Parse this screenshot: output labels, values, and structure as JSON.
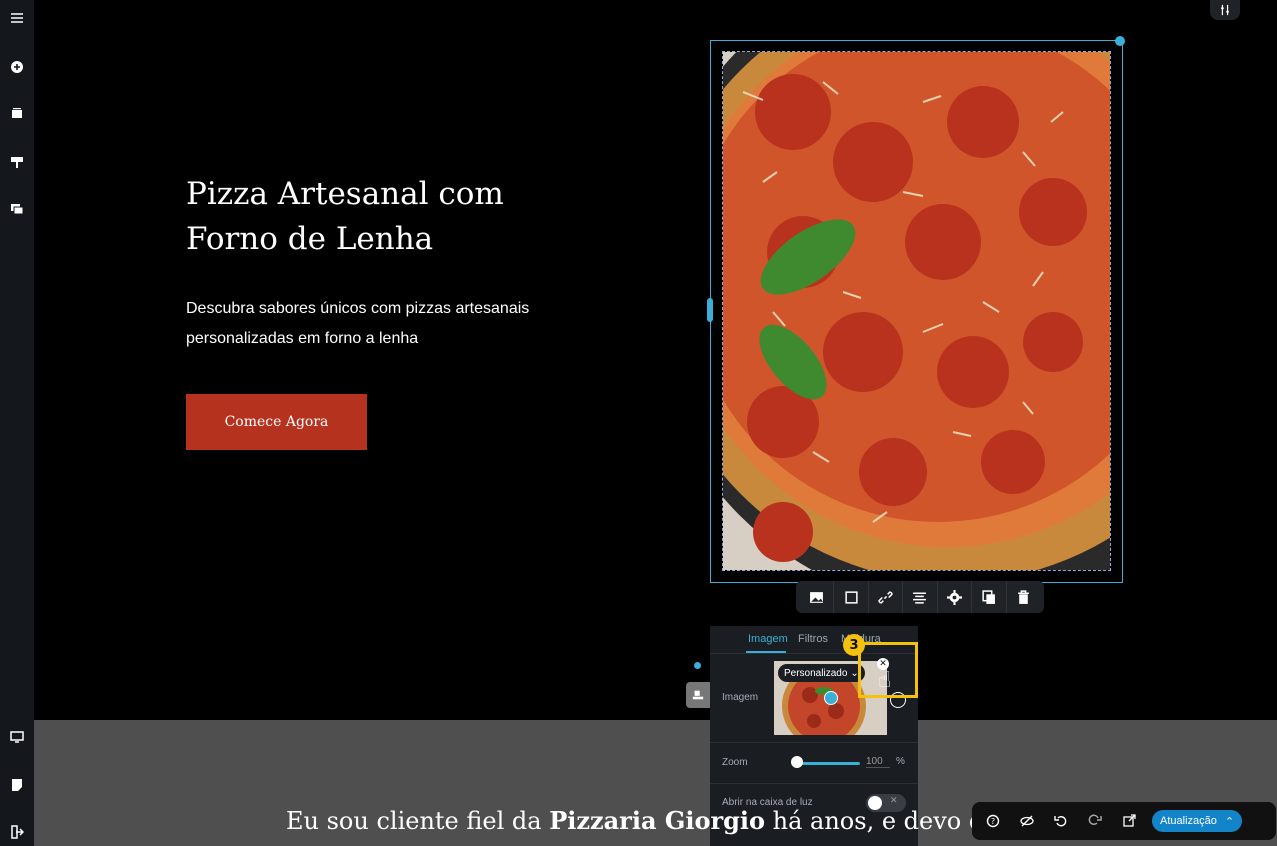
{
  "hero": {
    "title_line1": "Pizza Artesanal com",
    "title_line2": "Forno de Lenha",
    "subtitle_line1": "Descubra sabores únicos com pizzas artesanais",
    "subtitle_line2": "personalizadas em forno a lenha",
    "cta_label": "Comece Agora"
  },
  "panel": {
    "tabs": [
      "Imagem",
      "Filtros",
      "Moldura"
    ],
    "image_label": "Imagem",
    "preset_label": "Personalizado",
    "zoom_label": "Zoom",
    "zoom_value": "100",
    "zoom_unit": "%",
    "lightbox_label": "Abrir na caixa de luz"
  },
  "tutorial": {
    "step_number": "3"
  },
  "quote": {
    "prefix": "Eu sou cliente fiel da ",
    "brand": "Pizzaria Giorgio",
    "suffix": " há anos, e devo dizer que"
  },
  "bottom_bar": {
    "update_label": "Atualização"
  },
  "colors": {
    "accent": "#3ab0d8",
    "cta": "#b5321e",
    "highlight": "#f4c20d",
    "update": "#1384c8"
  }
}
